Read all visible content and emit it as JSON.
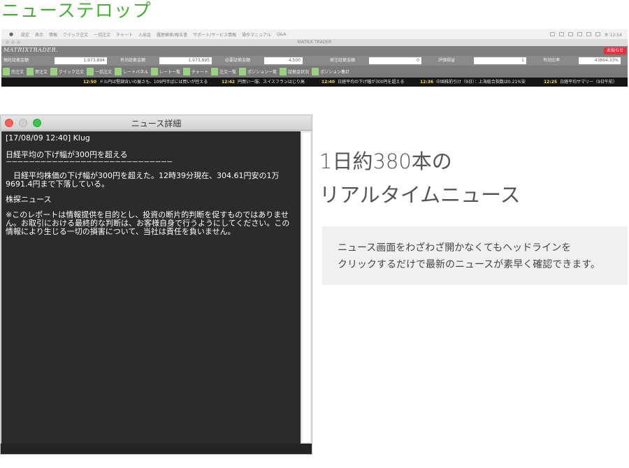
{
  "heading": "ニューステロップ",
  "app": {
    "menubar": {
      "menus": [
        "設定",
        "表示",
        "情報",
        "クイック注文",
        "一括注文",
        "チャート",
        "入出金",
        "履歴検索/報告書",
        "サポート/サービス情報",
        "操作マニュアル",
        "Q&A"
      ],
      "clock": "木 12:54"
    },
    "window_title": "MATRIX TRADER",
    "logo": "MATRIXTRADER.",
    "notice_label": "お知らせ",
    "account": [
      {
        "label": "預託証拠金額",
        "value": "1,973,894"
      },
      {
        "label": "有効証拠金額",
        "value": "1,973,895"
      },
      {
        "label": "必要証拠金額",
        "value": "4,500"
      },
      {
        "label": "発注証拠金額",
        "value": "0"
      },
      {
        "label": "評価損益",
        "value": "1"
      },
      {
        "label": "有効比率",
        "value": "43864.33%"
      }
    ],
    "toolbar": [
      "売注文",
      "買注文",
      "クイック注文",
      "一括注文",
      "レートパネル",
      "レート一覧",
      "チャート",
      "注文一覧",
      "ポジション一覧",
      "証拠金状況",
      "ポジション集計"
    ],
    "ticker": [
      {
        "time": "12:50",
        "text": "ドル円は堅調含いの展さも、109円半ばには買いが控える"
      },
      {
        "time": "12:42",
        "text": "円買い一服、スイスフランはじり高"
      },
      {
        "time": "12:40",
        "text": "日経平均の下げ幅が300円を超える"
      },
      {
        "time": "12:36",
        "text": "中国株前引け（9日）：上海総合指数は0.21%安"
      },
      {
        "time": "12:25",
        "text": "日経平均サマリー（9日午前）"
      }
    ]
  },
  "news_window": {
    "title": "ニュース詳細",
    "meta": "[17/08/09 12:40] Klug",
    "headline": "日経平均の下げ幅が300円を超える",
    "rule": "−−−−−−−−−−−−−−−−−−−−−−−−−−−−−",
    "body": "日経平均株価の下げ幅が300円を超えた。12時39分現在、304.61円安の1万9691.4円まで下落している。",
    "category": "株探ニュース",
    "disclaimer": "※このレポートは情報提供を目的とし、投資の断片的判断を促すものではありません。お取引における最終的な判断は、お客様自身で行うようにしてください。この情報により生じる一切の損害について、当社は責任を負いません。"
  },
  "promo": {
    "title_line1": "1日約380本の",
    "title_line2": "リアルタイムニュース",
    "desc_line1": "ニュース画面をわざわざ開かなくてもヘッドラインを",
    "desc_line2": "クリックするだけで最新のニュースが素早く確認できます。"
  }
}
